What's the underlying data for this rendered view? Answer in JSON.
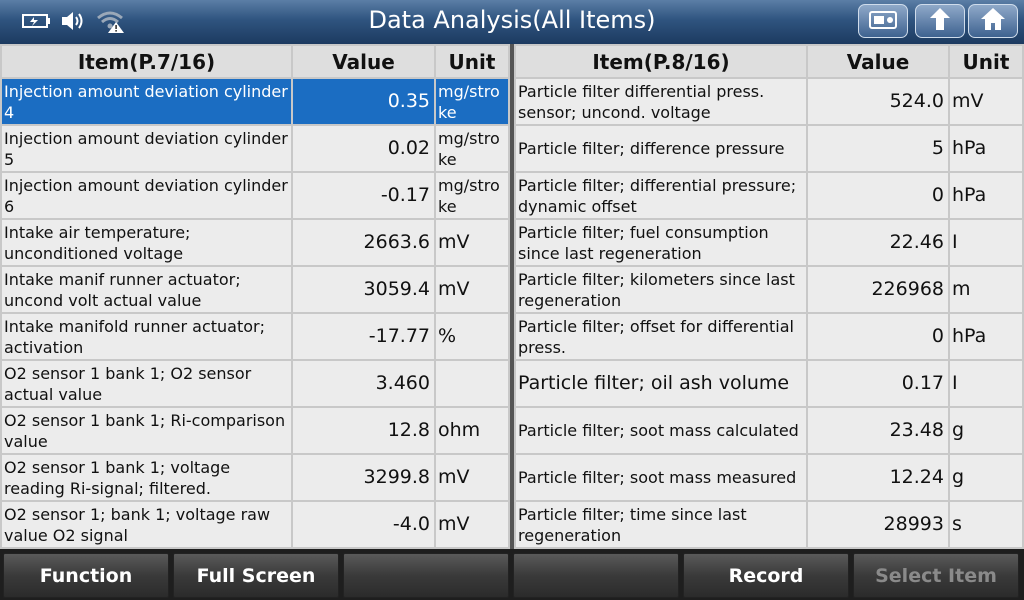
{
  "header": {
    "title": "Data Analysis(All Items)"
  },
  "toolbar": {
    "icons": [
      "battery-icon",
      "speaker-icon",
      "wifi-warning-icon",
      "screenshot-icon",
      "back-icon",
      "home-icon"
    ]
  },
  "left_table": {
    "col_item": "Item(P.7/16)",
    "col_value": "Value",
    "col_unit": "Unit",
    "rows": [
      {
        "item": "Injection amount deviation cylinder 4",
        "value": "0.35",
        "unit": "mg/stroke"
      },
      {
        "item": "Injection amount deviation cylinder 5",
        "value": "0.02",
        "unit": "mg/stroke"
      },
      {
        "item": "Injection amount deviation cylinder 6",
        "value": "-0.17",
        "unit": "mg/stroke"
      },
      {
        "item": "Intake air temperature; unconditioned voltage",
        "value": "2663.6",
        "unit": "mV"
      },
      {
        "item": "Intake manif runner actuator; uncond volt actual value",
        "value": "3059.4",
        "unit": "mV"
      },
      {
        "item": "Intake manifold runner actuator; activation",
        "value": "-17.77",
        "unit": "%"
      },
      {
        "item": "O2 sensor 1 bank 1; O2 sensor actual value",
        "value": "3.460",
        "unit": ""
      },
      {
        "item": "O2 sensor 1 bank 1; Ri-comparison value",
        "value": "12.8",
        "unit": "ohm"
      },
      {
        "item": "O2 sensor 1 bank 1; voltage reading Ri-signal; filtered.",
        "value": "3299.8",
        "unit": "mV"
      },
      {
        "item": "O2 sensor 1; bank 1; voltage raw value O2 signal",
        "value": "-4.0",
        "unit": "mV"
      }
    ]
  },
  "right_table": {
    "col_item": "Item(P.8/16)",
    "col_value": "Value",
    "col_unit": "Unit",
    "rows": [
      {
        "item": "Particle filter differential press. sensor; uncond. voltage",
        "value": "524.0",
        "unit": "mV"
      },
      {
        "item": "Particle filter; difference pressure",
        "value": "5",
        "unit": "hPa"
      },
      {
        "item": "Particle filter; differential pressure; dynamic offset",
        "value": "0",
        "unit": "hPa"
      },
      {
        "item": "Particle filter; fuel consumption since last regeneration",
        "value": "22.46",
        "unit": "I"
      },
      {
        "item": "Particle filter; kilometers since last regeneration",
        "value": "226968",
        "unit": "m"
      },
      {
        "item": "Particle filter; offset for differential press.",
        "value": "0",
        "unit": "hPa"
      },
      {
        "item": "Particle filter; oil ash volume",
        "value": "0.17",
        "unit": "I"
      },
      {
        "item": "Particle filter; soot mass calculated",
        "value": "23.48",
        "unit": "g"
      },
      {
        "item": "Particle filter; soot mass measured",
        "value": "12.24",
        "unit": "g"
      },
      {
        "item": "Particle filter; time since last regeneration",
        "value": "28993",
        "unit": "s"
      }
    ]
  },
  "bottom": {
    "function": "Function",
    "full_screen": "Full Screen",
    "blank1": "",
    "blank2": "",
    "record": "Record",
    "select_item": "Select Item"
  },
  "colors": {
    "selected_row": "#1b6dc2",
    "title_bar": "#2f547f"
  }
}
